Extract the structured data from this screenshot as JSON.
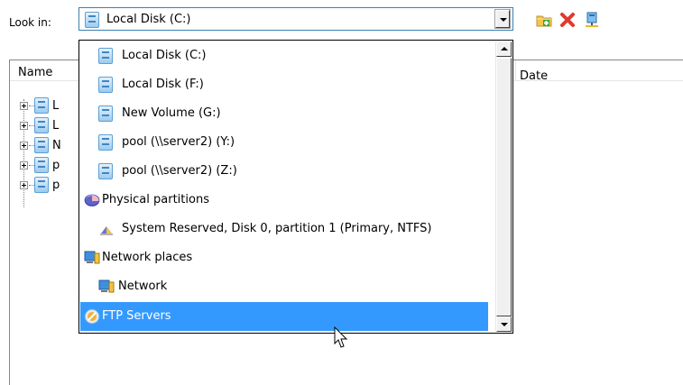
{
  "look_in": {
    "label": "Look in:",
    "selected": "Local Disk (C:)"
  },
  "toolbar": {
    "icons": [
      "new-folder-icon",
      "delete-icon",
      "network-drive-icon"
    ]
  },
  "list": {
    "columns": [
      "Name",
      "Date"
    ],
    "rows": [
      "L",
      "L",
      "N",
      "p",
      "p"
    ]
  },
  "dropdown": {
    "items": [
      {
        "label": "Local Disk (C:)",
        "icon": "disk-icon"
      },
      {
        "label": "Local Disk (F:)",
        "icon": "disk-icon"
      },
      {
        "label": "New Volume (G:)",
        "icon": "disk-icon"
      },
      {
        "label": "pool (\\\\server2) (Y:)",
        "icon": "disk-icon"
      },
      {
        "label": "pool (\\\\server2) (Z:)",
        "icon": "disk-icon"
      },
      {
        "label": "Physical partitions",
        "icon": "partitions-icon"
      },
      {
        "label": "System Reserved, Disk 0, partition 1 (Primary, NTFS)",
        "icon": "partition-icon"
      },
      {
        "label": "Network places",
        "icon": "network-places-icon"
      },
      {
        "label": "Network",
        "icon": "network-icon"
      },
      {
        "label": "FTP Servers",
        "icon": "ftp-icon"
      }
    ],
    "highlighted_index": 9
  },
  "colors": {
    "selection": "#3399ff",
    "combo_border": "#3c7fb1"
  }
}
